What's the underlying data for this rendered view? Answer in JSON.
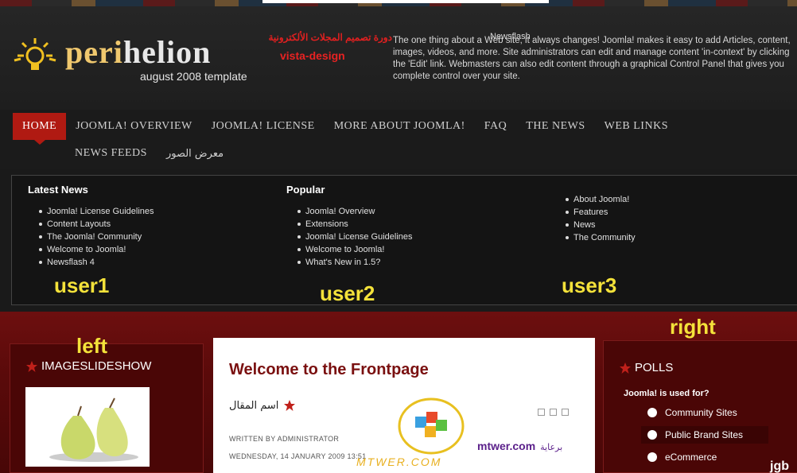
{
  "header": {
    "brand_part1": "peri",
    "brand_part2": "helion",
    "brand_sub": "august 2008 template",
    "arabic_title": "دورة تصميم المجلات الألكترونية",
    "vista_design": "vista-design",
    "newsflash_label": "Newsflash",
    "newsflash_text": "The one thing about a Web site, it always changes! Joomla! makes it easy to add Articles, content, images, videos, and more. Site administrators can edit and manage content 'in-context' by clicking the 'Edit' link. Webmasters can also edit content through a graphical Control Panel that gives you complete control over your site."
  },
  "nav": {
    "row1": [
      "HOME",
      "JOOMLA! OVERVIEW",
      "JOOMLA! LICENSE",
      "MORE ABOUT JOOMLA!",
      "FAQ",
      "THE NEWS",
      "WEB LINKS"
    ],
    "row2": [
      "NEWS FEEDS",
      "معرض الصور"
    ],
    "active": "HOME"
  },
  "user1": {
    "title": "Latest News",
    "items": [
      "Joomla! License Guidelines",
      "Content Layouts",
      "The Joomla! Community",
      "Welcome to Joomla!",
      "Newsflash 4"
    ],
    "label": "user1"
  },
  "user2": {
    "title": "Popular",
    "items": [
      "Joomla! Overview",
      "Extensions",
      "Joomla! License Guidelines",
      "Welcome to Joomla!",
      "What's New in 1.5?"
    ],
    "label": "user2"
  },
  "user3": {
    "items": [
      "About Joomla!",
      "Features",
      "News",
      "The Community"
    ],
    "label": "user3"
  },
  "left": {
    "label": "left",
    "module_title": "IMAGESLIDESHOW"
  },
  "main": {
    "title": "Welcome to the Frontpage",
    "article_name": "اسم المقال",
    "written_by": "WRITTEN BY ADMINISTRATOR",
    "date": "WEDNESDAY, 14 JANUARY 2009 13:51",
    "watermark": "MTWER.COM",
    "sponsor_site": "mtwer.com",
    "sponsor_ar": "برعاية"
  },
  "right": {
    "label": "right",
    "module_title": "POLLS",
    "question": "Joomla! is used for?",
    "options": [
      "Community Sites",
      "Public Brand Sites",
      "eCommerce"
    ]
  },
  "corner_logo": "jgb"
}
